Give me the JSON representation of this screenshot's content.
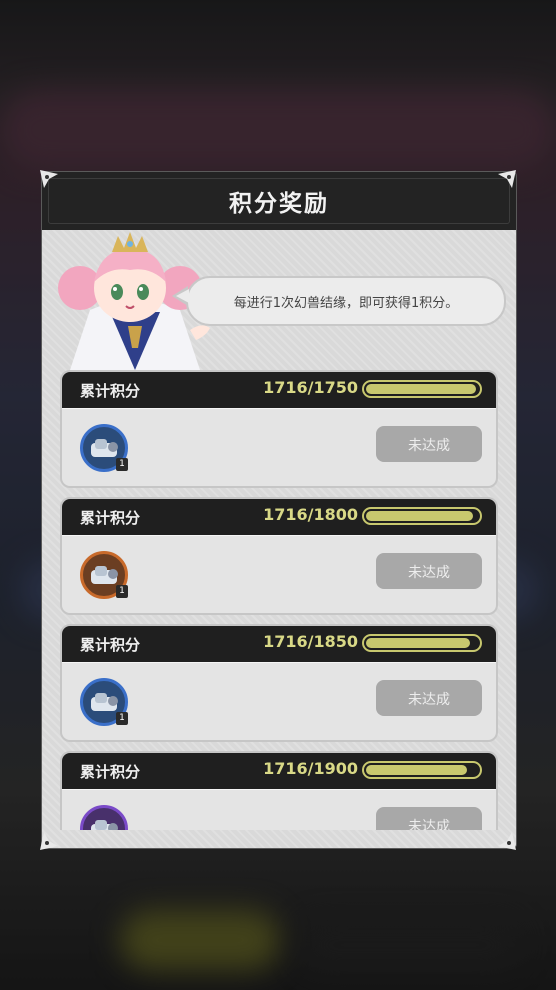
{
  "panel": {
    "title": "积分奖励",
    "hint": "每进行1次幻兽结缘，即可获得1积分。"
  },
  "rewards": [
    {
      "label": "累计积分",
      "score_text": "1716/1750",
      "current": 1716,
      "target": 1750,
      "progress": 0.981,
      "item_count": "1",
      "frame_color": "blue",
      "status": "未达成"
    },
    {
      "label": "累计积分",
      "score_text": "1716/1800",
      "current": 1716,
      "target": 1800,
      "progress": 0.953,
      "item_count": "1",
      "frame_color": "orange",
      "status": "未达成"
    },
    {
      "label": "累计积分",
      "score_text": "1716/1850",
      "current": 1716,
      "target": 1850,
      "progress": 0.928,
      "item_count": "1",
      "frame_color": "blue",
      "status": "未达成"
    },
    {
      "label": "累计积分",
      "score_text": "1716/1900",
      "current": 1716,
      "target": 1900,
      "progress": 0.903,
      "item_count": "1",
      "frame_color": "purple",
      "status": "未达成"
    }
  ],
  "colors": {
    "accent": "#c8c86e",
    "header": "#1f1f1f",
    "button_disabled": "#a8a8a8"
  }
}
